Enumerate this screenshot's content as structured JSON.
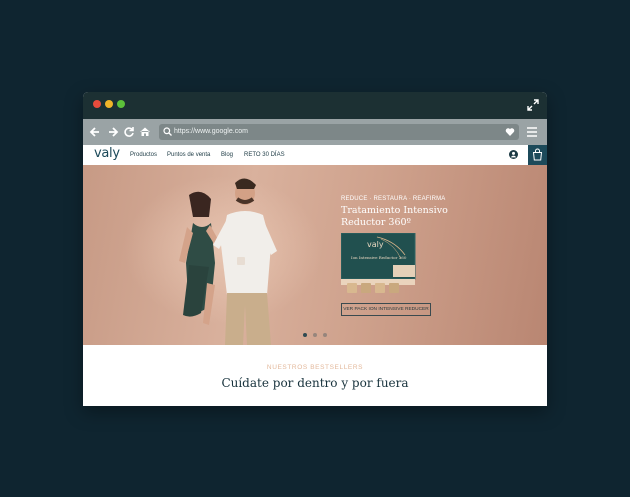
{
  "browser": {
    "url": "https://www.google.com"
  },
  "site": {
    "logo": "valy",
    "nav": [
      "Productos",
      "Puntos de venta",
      "Blog",
      "RETO 30 DÍAS"
    ]
  },
  "hero": {
    "tagline": "REDUCE · RESTAURA · REAFIRMA",
    "title": "Tratamiento Intensivo Reductor 360º",
    "product_brand": "valy",
    "product_name": "Ion Intensive Reductor 360",
    "cta_label": "VER PACK ION INTENSIVE REDUCER",
    "carousel": {
      "slides": 3,
      "active": 1
    }
  },
  "bestsellers": {
    "label": "NUESTROS BESTSELLERS",
    "title": "Cuídate por dentro y por fuera"
  },
  "colors": {
    "page_bg": "#0f2530",
    "brand": "#1c4a5a",
    "accent": "#e3b89b"
  }
}
